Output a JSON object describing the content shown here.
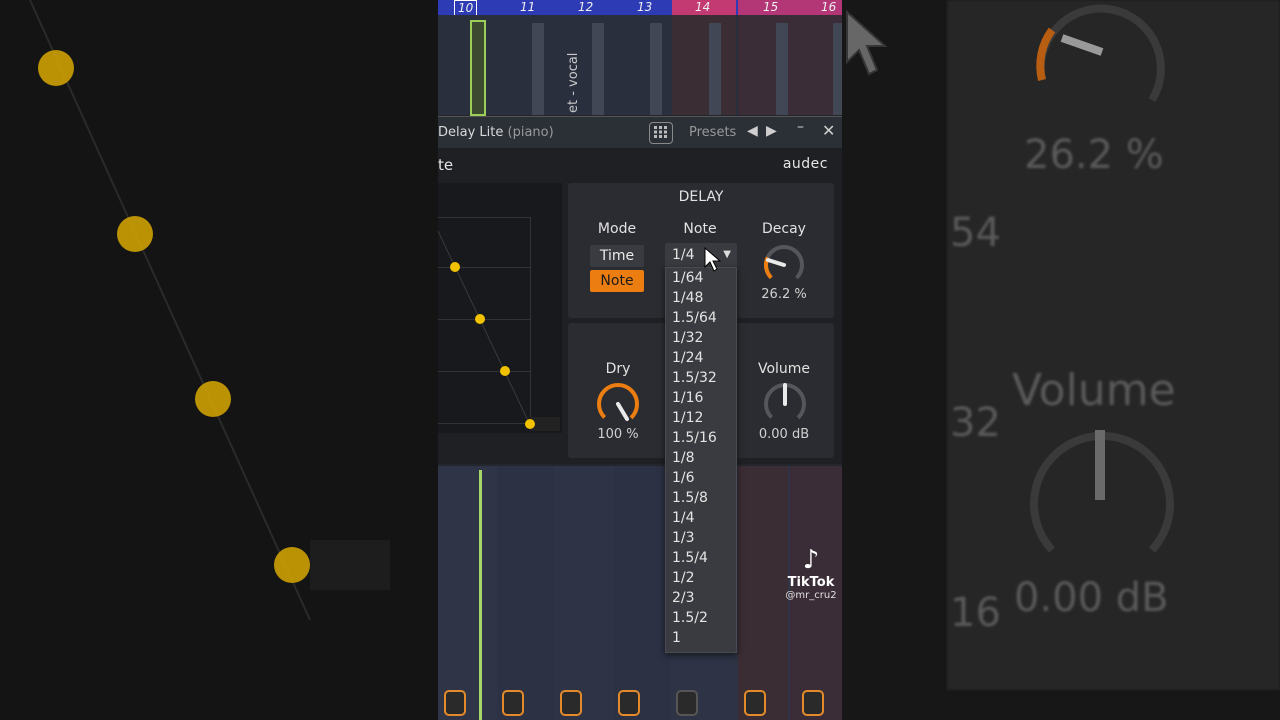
{
  "background_right": {
    "decay_value": "26.2 %",
    "partial_a": "54",
    "partial_b": "32",
    "partial_c": "16",
    "volume_label": "Volume",
    "volume_value": "0.00 dB"
  },
  "ruler": {
    "marks": [
      "10",
      "11",
      "12",
      "13",
      "14",
      "15",
      "16"
    ],
    "selected": "10"
  },
  "track": {
    "name": "et - vocal"
  },
  "window": {
    "title": "Delay Lite",
    "subtitle": "(piano)",
    "presets_label": "Presets"
  },
  "plugin": {
    "name": "te",
    "brand": "audec",
    "section_title": "DELAY",
    "mode": {
      "label": "Mode",
      "options": [
        "Time",
        "Note"
      ],
      "selected": "Note"
    },
    "note": {
      "label": "Note",
      "value": "1/4",
      "options": [
        "1/64",
        "1/48",
        "1.5/64",
        "1/32",
        "1/24",
        "1.5/32",
        "1/16",
        "1/12",
        "1.5/16",
        "1/8",
        "1/6",
        "1.5/8",
        "1/4",
        "1/3",
        "1.5/4",
        "1/2",
        "2/3",
        "1.5/2",
        "1"
      ]
    },
    "decay": {
      "label": "Decay",
      "value": "26.2 %",
      "level": 0.262
    },
    "dry": {
      "label": "Dry",
      "value": "100 %",
      "level": 1.0
    },
    "volume": {
      "label": "Volume",
      "value": "0.00 dB",
      "level": 0.5
    }
  },
  "watermark": {
    "name": "TikTok",
    "user": "@mr_cru2"
  },
  "colors": {
    "accent": "#ec7d11",
    "ruler_blue": "#2d3bb5",
    "ruler_pink": "#c33a72",
    "dot_yellow": "#f2c100",
    "selected_green": "#9bcf59"
  }
}
